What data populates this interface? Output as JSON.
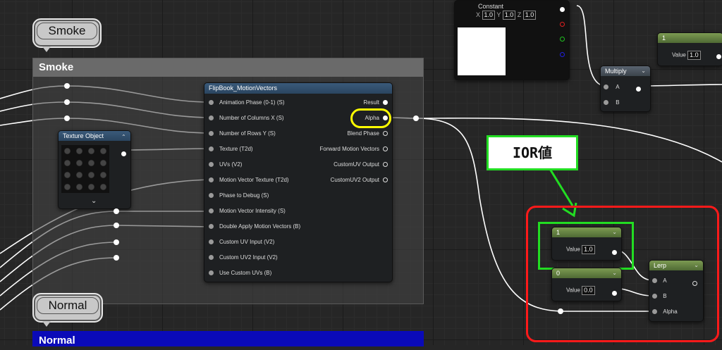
{
  "comments": {
    "smoke": {
      "bubble": "Smoke",
      "header": "Smoke"
    },
    "normal": {
      "bubble": "Normal",
      "header": "Normal"
    }
  },
  "constant_node": {
    "title": "Constant",
    "x_label": "X",
    "x_value": "1.0",
    "y_label": "Y",
    "y_value": "1.0",
    "z_label": "Z",
    "z_value": "1.0"
  },
  "value_node_top": {
    "title": "1",
    "value_label": "Value",
    "value": "1.0"
  },
  "multiply_node": {
    "title": "Multiply",
    "input_a": "A",
    "input_b": "B"
  },
  "flipbook_node": {
    "title": "FlipBook_MotionVectors",
    "inputs": [
      "Animation Phase (0-1) (S)",
      "Number of Columns X (S)",
      "Number of Rows Y (S)",
      "Texture (T2d)",
      "UVs (V2)",
      "Motion Vector Texture (T2d)",
      "Phase to Debug (S)",
      "Motion Vector Intensity (S)",
      "Double Apply Motion Vectors (B)",
      "Custom UV Input (V2)",
      "Custom UV2 Input (V2)",
      "Use Custom UVs (B)"
    ],
    "outputs": [
      "Result",
      "Alpha",
      "Blend Phase",
      "Forward Motion Vectors",
      "CustomUV Output",
      "CustomUV2 Output"
    ]
  },
  "texture_node": {
    "title": "Texture Object"
  },
  "annotation": {
    "label": "IOR値",
    "border_color": "#22dd22",
    "frame_color": "#ff1a1a",
    "highlight_color": "#ffff00"
  },
  "value_node_ior": {
    "title": "1",
    "value_label": "Value",
    "value": "1.0"
  },
  "value_node_zero": {
    "title": "0",
    "value_label": "Value",
    "value": "0.0"
  },
  "lerp_node": {
    "title": "Lerp",
    "input_a": "A",
    "input_b": "B",
    "input_alpha": "Alpha"
  }
}
